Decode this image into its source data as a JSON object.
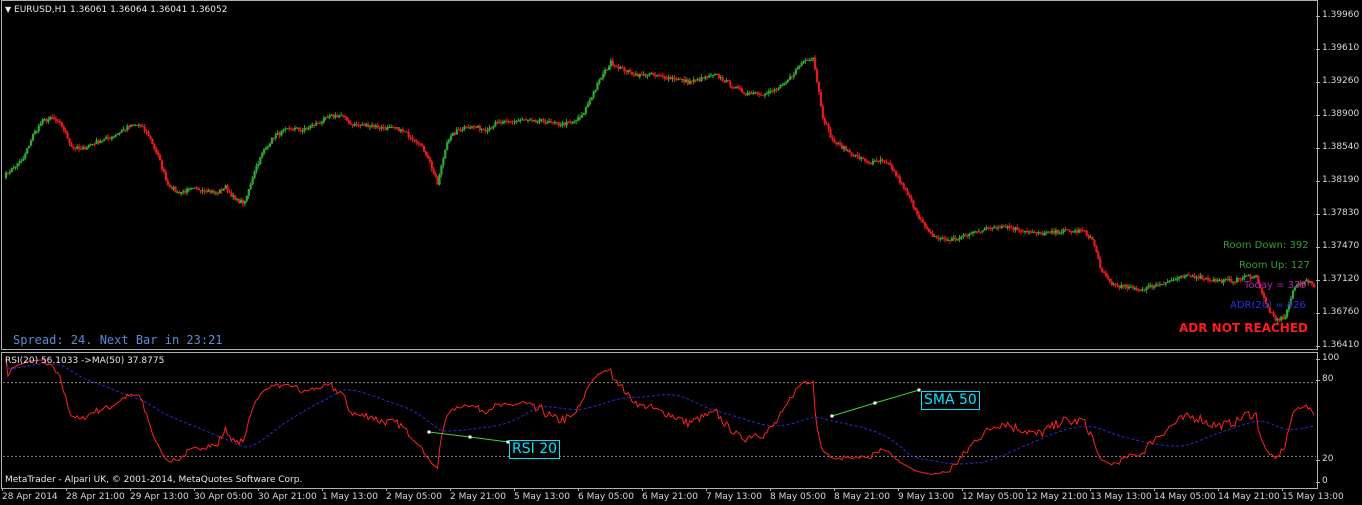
{
  "window": {
    "symbol_label": "EURUSD,H1  1.36061 1.36064 1.36041 1.36052",
    "copyright": "MetaTrader - Alpari UK, © 2001-2014, MetaQuotes Software Corp."
  },
  "colors": {
    "background": "#000000",
    "bull": "#2ea82e",
    "bear": "#e31b1b",
    "rsi_line": "#ff2020",
    "ma_line": "#2828d8",
    "annotation": "#00e5ff"
  },
  "hud": {
    "spread": "Spread: 24. Next Bar in 23:21",
    "room_down": "Room Down: 392",
    "room_up": "Room Up: 127",
    "today": "Today = 339",
    "adr": "ADR(20) = 426",
    "alert": "ADR NOT REACHED"
  },
  "price_axis": [
    "1.39960",
    "1.39610",
    "1.39260",
    "1.38900",
    "1.38540",
    "1.38190",
    "1.37830",
    "1.37470",
    "1.37120",
    "1.36760",
    "1.36410"
  ],
  "indicator": {
    "label": "RSI(20) 56.1033  ->MA(50) 37.8775",
    "levels": [
      "100",
      "80",
      "20",
      "0"
    ],
    "rsi_tag": "RSI 20",
    "sma_tag": "SMA 50"
  },
  "time_axis": [
    "28 Apr 2014",
    "28 Apr 21:00",
    "29 Apr 13:00",
    "30 Apr 05:00",
    "30 Apr 21:00",
    "1 May 13:00",
    "2 May 05:00",
    "2 May 21:00",
    "5 May 13:00",
    "6 May 05:00",
    "6 May 21:00",
    "7 May 13:00",
    "8 May 05:00",
    "8 May 21:00",
    "9 May 13:00",
    "12 May 05:00",
    "12 May 21:00",
    "13 May 13:00",
    "14 May 05:00",
    "14 May 21:00",
    "15 May 13:00"
  ],
  "chart_data": {
    "type": "line",
    "symbol": "EURUSD",
    "timeframe": "H1",
    "close_price": [
      1.3824,
      1.3833,
      1.3842,
      1.3868,
      1.3883,
      1.3886,
      1.3878,
      1.3856,
      1.3852,
      1.3858,
      1.3862,
      1.3865,
      1.3871,
      1.3877,
      1.3879,
      1.3868,
      1.3845,
      1.3815,
      1.3806,
      1.3808,
      1.381,
      1.3809,
      1.3805,
      1.3812,
      1.3798,
      1.3795,
      1.383,
      1.3852,
      1.3866,
      1.3872,
      1.3875,
      1.3873,
      1.3878,
      1.3883,
      1.3888,
      1.3889,
      1.388,
      1.3878,
      1.3879,
      1.3876,
      1.3875,
      1.3874,
      1.3868,
      1.3861,
      1.3845,
      1.3815,
      1.3862,
      1.3872,
      1.3878,
      1.3876,
      1.3874,
      1.388,
      1.3881,
      1.3883,
      1.3884,
      1.3882,
      1.3883,
      1.388,
      1.388,
      1.3881,
      1.3888,
      1.391,
      1.393,
      1.3946,
      1.394,
      1.3935,
      1.3932,
      1.3933,
      1.3931,
      1.393,
      1.3928,
      1.3925,
      1.3927,
      1.393,
      1.3932,
      1.3925,
      1.3918,
      1.3913,
      1.3914,
      1.3912,
      1.3916,
      1.3922,
      1.3935,
      1.3948,
      1.3952,
      1.3888,
      1.3862,
      1.3855,
      1.3848,
      1.3842,
      1.3838,
      1.384,
      1.3835,
      1.3818,
      1.38,
      1.378,
      1.3762,
      1.3757,
      1.3755,
      1.3757,
      1.376,
      1.3765,
      1.3767,
      1.377,
      1.377,
      1.3767,
      1.3765,
      1.3762,
      1.3762,
      1.3763,
      1.3765,
      1.3764,
      1.3765,
      1.3755,
      1.372,
      1.3708,
      1.3705,
      1.3703,
      1.3702,
      1.3705,
      1.3708,
      1.3711,
      1.3714,
      1.3716,
      1.3716,
      1.3713,
      1.3711,
      1.3711,
      1.3712,
      1.3716,
      1.3716,
      1.3686,
      1.3668,
      1.3673,
      1.3705,
      1.3712,
      1.3706
    ]
  }
}
